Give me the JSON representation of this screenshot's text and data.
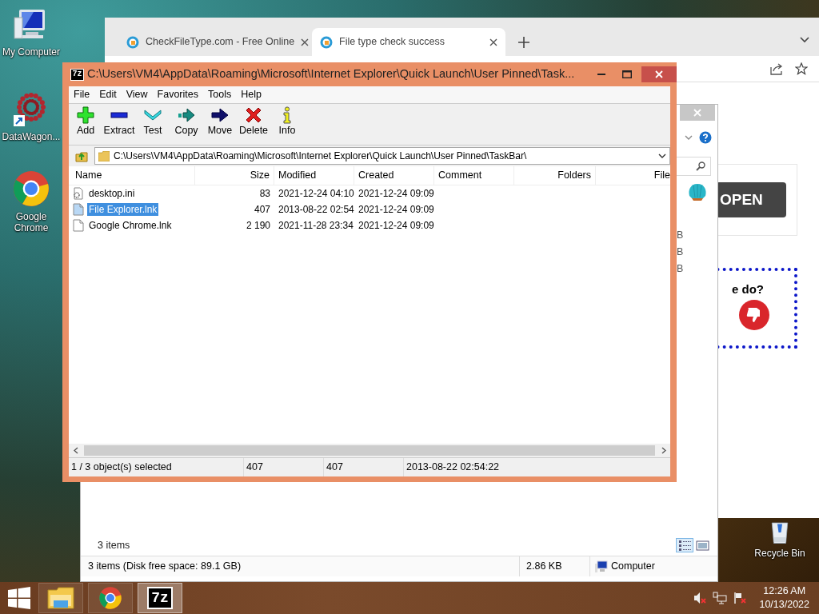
{
  "desktop_icons": [
    {
      "kind": "computer",
      "label": "My Computer"
    },
    {
      "kind": "datawagon",
      "label": "DataWagon..."
    },
    {
      "kind": "chrome",
      "label": "Google Chrome"
    },
    {
      "kind": "recycle",
      "label": "Recycle Bin"
    }
  ],
  "browser": {
    "tabs": [
      {
        "label": "CheckFileType.com - Free Online",
        "selected": false
      },
      {
        "label": "File type check success",
        "selected": true
      }
    ],
    "page": {
      "open_button": "OPEN",
      "question": "e do?"
    }
  },
  "explorer": {
    "list": [
      "B",
      "B",
      "B"
    ],
    "item_count": "3 items",
    "views": [
      {
        "kind": "details",
        "selected": true
      },
      {
        "kind": "tiles",
        "selected": false
      }
    ],
    "status_bar": {
      "summary": "3 items (Disk free space: 89.1 GB)",
      "size": "2.86 KB",
      "location": "Computer"
    }
  },
  "sevenzip": {
    "icon_text": "7z",
    "title": "C:\\Users\\VM4\\AppData\\Roaming\\Microsoft\\Internet Explorer\\Quick Launch\\User Pinned\\Task...",
    "menu": [
      "File",
      "Edit",
      "View",
      "Favorites",
      "Tools",
      "Help"
    ],
    "toolbar": [
      {
        "kind": "add",
        "label": "Add"
      },
      {
        "kind": "extract",
        "label": "Extract"
      },
      {
        "kind": "test",
        "label": "Test"
      },
      {
        "kind": "copy",
        "label": "Copy"
      },
      {
        "kind": "move",
        "label": "Move"
      },
      {
        "kind": "delete",
        "label": "Delete"
      },
      {
        "kind": "info",
        "label": "Info"
      }
    ],
    "path": "C:\\Users\\VM4\\AppData\\Roaming\\Microsoft\\Internet Explorer\\Quick Launch\\User Pinned\\TaskBar\\",
    "columns": [
      "Name",
      "Size",
      "Modified",
      "Created",
      "Comment",
      "Folders",
      "File"
    ],
    "rows": [
      {
        "kind": "settings",
        "name": "desktop.ini",
        "size": "83",
        "modified": "2021-12-24 04:10",
        "created": "2021-12-24 09:09",
        "selected": false
      },
      {
        "kind": "link",
        "name": "File Explorer.lnk",
        "size": "407",
        "modified": "2013-08-22 02:54",
        "created": "2021-12-24 09:09",
        "selected": true
      },
      {
        "kind": "link",
        "name": "Google Chrome.lnk",
        "size": "2 190",
        "modified": "2021-11-28 23:34",
        "created": "2021-12-24 09:09",
        "selected": false
      }
    ],
    "status_bar": [
      "1 / 3 object(s) selected",
      "407",
      "407",
      "2013-08-22 02:54:22"
    ]
  },
  "taskbar": {
    "apps": [
      {
        "kind": "explorer",
        "selected": false
      },
      {
        "kind": "chrome",
        "selected": false
      },
      {
        "kind": "sevenzip",
        "icon_text": "7z",
        "selected": true
      }
    ],
    "time": "12:26 AM",
    "date": "10/13/2022"
  }
}
